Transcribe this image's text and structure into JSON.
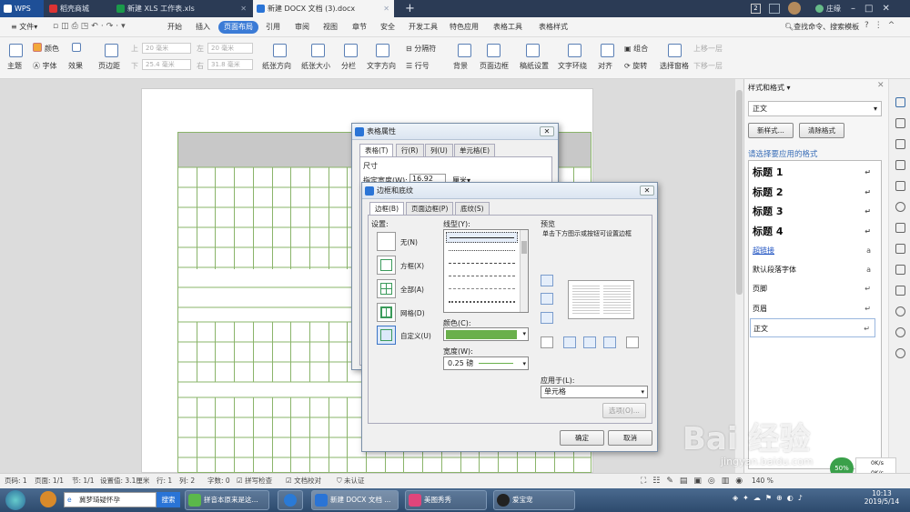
{
  "tabs": [
    {
      "label": "WPS",
      "color": "#1b5fc5"
    },
    {
      "label": "稻壳商城",
      "color": "#d33"
    },
    {
      "label": "新建 XLS 工作表.xls",
      "color": "#1a9a4a"
    },
    {
      "label": "新建 DOCX 文档 (3).docx",
      "color": "#2a74d6"
    }
  ],
  "window_badge": "2",
  "user": "庄缘",
  "menu": {
    "file": "文件",
    "items": [
      "开始",
      "插入",
      "页面布局",
      "引用",
      "审阅",
      "视图",
      "章节",
      "安全",
      "开发工具",
      "特色应用",
      "表格工具",
      "表格样式"
    ],
    "selected": "页面布局",
    "search": "查找命令、搜索模板"
  },
  "toolbar": {
    "theme": "主题",
    "color": "颜色",
    "font": "字体",
    "effect": "效果",
    "margin": "页边距",
    "top_label": "上",
    "top_val": "20 毫米",
    "bottom_label": "下",
    "bottom_val": "20 毫米",
    "left_label": "左",
    "left_val": "25.4 毫米",
    "right_label": "右",
    "right_val": "31.8 毫米",
    "orientation": "纸张方向",
    "size": "纸张大小",
    "columns": "分栏",
    "text_dir": "文字方向",
    "separator": "分隔符",
    "line_num": "行号",
    "background": "背景",
    "border": "页面边框",
    "draft": "稿纸设置",
    "wrap": "文字环绕",
    "align": "对齐",
    "group": "组合",
    "rotate": "旋转",
    "select": "选择窗格",
    "up": "上移一层",
    "down": "下移一层"
  },
  "table_props": {
    "title": "表格属性",
    "tabs": [
      "表格(T)",
      "行(R)",
      "列(U)",
      "单元格(E)"
    ],
    "size_label": "尺寸",
    "width_label": "指定宽度(W):",
    "width_val": "16.92",
    "unit": "厘米"
  },
  "border_dialog": {
    "title": "边框和底纹",
    "tabs": [
      "边框(B)",
      "页面边框(P)",
      "底纹(S)"
    ],
    "settings_label": "设置:",
    "settings": [
      "无(N)",
      "方框(X)",
      "全部(A)",
      "网格(D)",
      "自定义(U)"
    ],
    "linetype_label": "线型(Y):",
    "color_label": "颜色(C):",
    "color_value": "#6ab04c",
    "width_label": "宽度(W):",
    "width_val": "0.25 磅",
    "preview_label": "预览",
    "preview_hint": "单击下方图示或按钮可设置边框",
    "apply_label": "应用于(L):",
    "apply_val": "单元格",
    "options_btn": "选项(O)...",
    "ok": "确定",
    "cancel": "取消"
  },
  "styles_panel": {
    "title": "样式和格式",
    "current": "正文",
    "new_btn": "新样式...",
    "clear_btn": "清除格式",
    "hint": "请选择要应用的格式",
    "items": [
      "标题 1",
      "标题 2",
      "标题 3",
      "标题 4",
      "超链接",
      "默认段落字体",
      "页脚",
      "页眉",
      "正文"
    ]
  },
  "status": {
    "page": "页码: 1",
    "pages": "页面: 1/1",
    "section": "节: 1/1",
    "setting": "设置值: 3.1厘米",
    "row": "行: 1",
    "col": "列: 2",
    "words": "字数: 0",
    "spell": "拼写检查",
    "proof": "文档校对",
    "cert": "未认证",
    "zoom": "140 %"
  },
  "taskbar": {
    "search_placeholder": "冀梦琦疑怀孕",
    "search_btn": "搜索",
    "items": [
      "拼音本原来是这...",
      "新建 DOCX 文档 ...",
      "美图秀秀",
      "爱宝宠"
    ],
    "time": "10:13",
    "date": "2019/5/14"
  },
  "watermark": "Bai 经验",
  "watermark_sub": "jingyan.baidu.com",
  "net": {
    "up": "0K/s",
    "down": "0K/s",
    "pct": "50%"
  }
}
